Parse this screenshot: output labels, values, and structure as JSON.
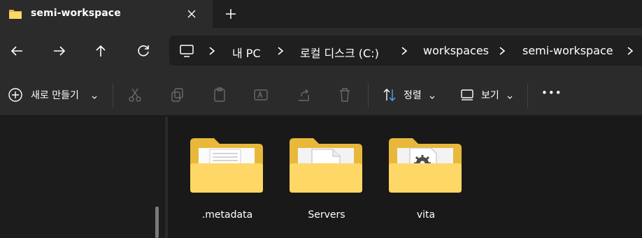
{
  "tab": {
    "title": "semi-workspace",
    "icon": "folder-icon"
  },
  "nav": {
    "back": "back-arrow-icon",
    "forward": "forward-arrow-icon",
    "up": "up-arrow-icon",
    "refresh": "refresh-icon"
  },
  "breadcrumb": {
    "items": [
      "내 PC",
      "로컬 디스크 (C:)",
      "workspaces",
      "semi-workspace"
    ]
  },
  "toolbar": {
    "new_label": "새로 만들기",
    "sort_label": "정렬",
    "view_label": "보기",
    "more_label": "•••"
  },
  "folders": [
    {
      "name": ".metadata",
      "preview": "document"
    },
    {
      "name": "Servers",
      "preview": "blank-page"
    },
    {
      "name": "vita",
      "preview": "gear-file"
    }
  ],
  "colors": {
    "folder_back": "#e8b83a",
    "folder_front": "#ffd766",
    "accent": "#ffffff"
  }
}
